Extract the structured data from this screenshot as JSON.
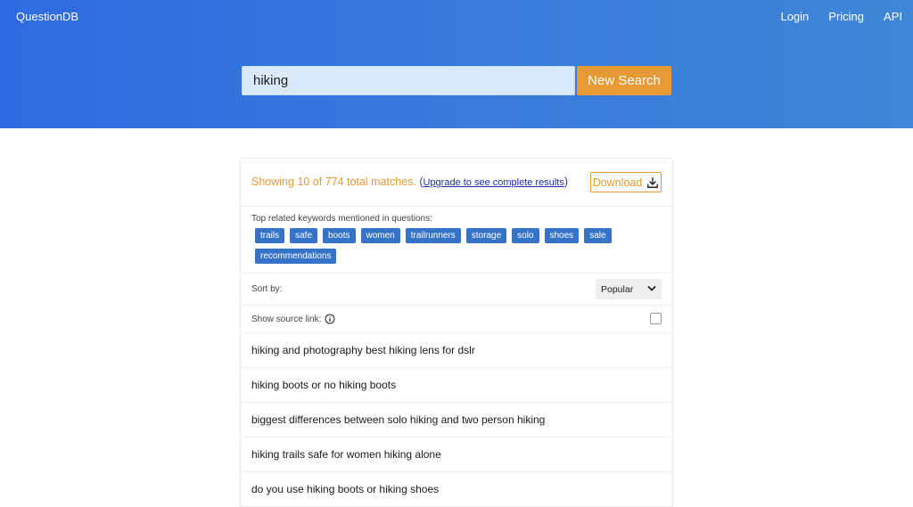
{
  "header": {
    "brand": "QuestionDB",
    "nav": [
      "Login",
      "Pricing",
      "API"
    ]
  },
  "search": {
    "value": "hiking",
    "button_label": "New Search"
  },
  "results": {
    "showing_text": "Showing 10 of 774 total matches.",
    "paren_open": "(",
    "upgrade_link": "Upgrade to see complete results",
    "paren_close": ")",
    "download_label": "Download",
    "keywords_title": "Top related keywords mentioned in questions:",
    "keywords": [
      "trails",
      "safe",
      "boots",
      "women",
      "trailrunners",
      "storage",
      "solo",
      "shoes",
      "sale",
      "recommendations"
    ],
    "sort_label": "Sort by:",
    "sort_value": "Popular",
    "source_label": "Show source link:",
    "source_checked": false,
    "questions": [
      "hiking and photography best hiking lens for dslr",
      "hiking boots or no hiking boots",
      "biggest differences between solo hiking and two person hiking",
      "hiking trails safe for women hiking alone",
      "do you use hiking boots or hiking shoes"
    ]
  },
  "colors": {
    "accent_orange": "#e69a35",
    "chip_blue": "#3573c9",
    "hero_blue": "#2f6ae0"
  }
}
